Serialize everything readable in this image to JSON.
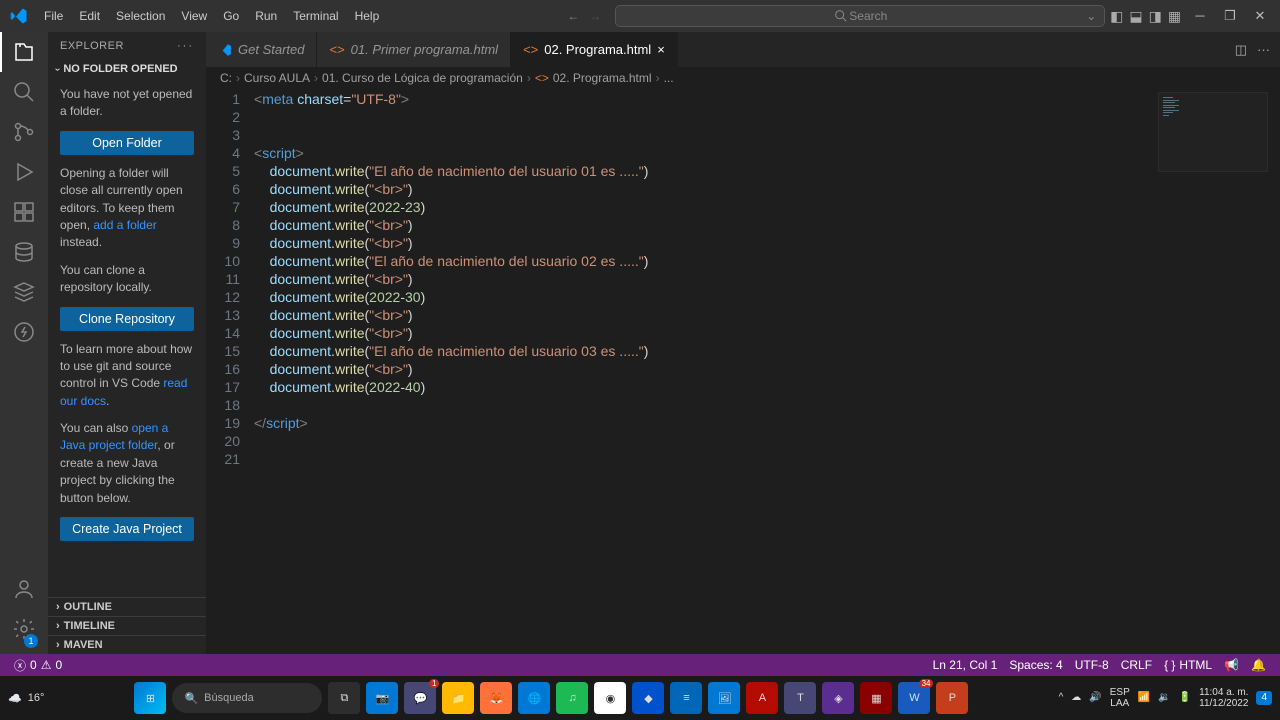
{
  "menu": {
    "items": [
      "File",
      "Edit",
      "Selection",
      "View",
      "Go",
      "Run",
      "Terminal",
      "Help"
    ]
  },
  "search_placeholder": "Search",
  "sidebar": {
    "title": "EXPLORER",
    "section": "NO FOLDER OPENED",
    "para1": "You have not yet opened a folder.",
    "btn_open": "Open Folder",
    "para2a": "Opening a folder will close all currently open editors. To keep them open, ",
    "link_add": "add a folder",
    "para2b": " instead.",
    "para3": "You can clone a repository locally.",
    "btn_clone": "Clone Repository",
    "para4a": "To learn more about how to use git and source control in VS Code ",
    "link_docs": "read our docs",
    "para4b": ".",
    "para5a": "You can also ",
    "link_java": "open a Java project folder",
    "para5b": ", or create a new Java project by clicking the button below.",
    "btn_java": "Create Java Project",
    "outline": "OUTLINE",
    "timeline": "TIMELINE",
    "maven": "MAVEN"
  },
  "tabs": {
    "t1": "Get Started",
    "t2": "01. Primer programa.html",
    "t3": "02. Programa.html"
  },
  "crumbs": {
    "c1": "C:",
    "c2": "Curso AULA",
    "c3": "01. Curso de Lógica de programación",
    "c4": "02. Programa.html",
    "c5": "..."
  },
  "code": {
    "lines": [
      1,
      2,
      3,
      4,
      5,
      6,
      7,
      8,
      9,
      10,
      11,
      12,
      13,
      14,
      15,
      16,
      17,
      18,
      19,
      20,
      21
    ],
    "l1_meta": "meta",
    "l1_charset": "charset",
    "l1_val": "\"UTF-8\"",
    "script_open": "script",
    "script_close": "script",
    "doc": "document",
    "write": "write",
    "s5": "\"El año de nacimiento del usuario 01 es .....\"",
    "sbr": "\"<br>\"",
    "n7a": "2022",
    "n7b": "23",
    "s10": "\"El año de nacimiento del usuario 02 es .....\"",
    "n12a": "2022",
    "n12b": "30",
    "s15": "\"El año de nacimiento del usuario 03 es .....\"",
    "n17a": "2022",
    "n17b": "40"
  },
  "status": {
    "err": "0",
    "warn": "0",
    "pos": "Ln 21, Col 1",
    "spaces": "Spaces: 4",
    "enc": "UTF-8",
    "eol": "CRLF",
    "lang": "HTML"
  },
  "taskbar": {
    "temp": "16°",
    "search": "Búsqueda",
    "teams_badge": "1",
    "word_badge": "34",
    "lang1": "ESP",
    "lang2": "LAA",
    "time": "11:04 a. m.",
    "date": "11/12/2022",
    "notif": "4"
  },
  "gear_badge": "1"
}
